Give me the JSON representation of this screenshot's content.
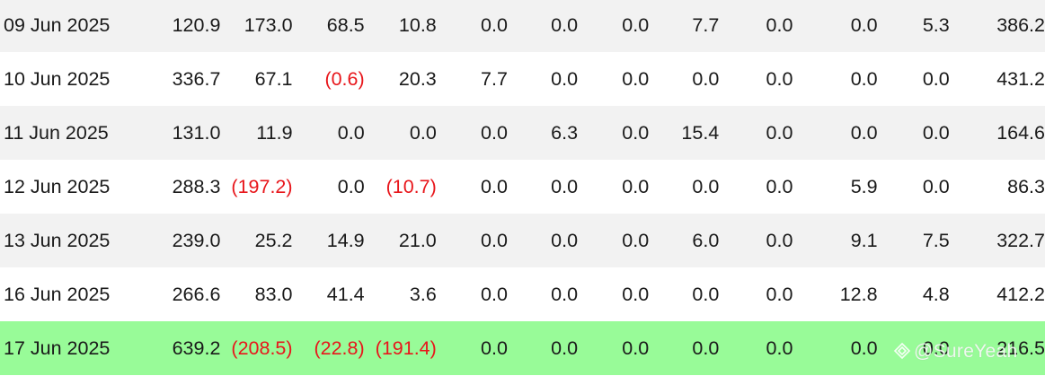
{
  "table": {
    "rows": [
      {
        "date": "09 Jun 2025",
        "values": [
          "120.9",
          "173.0",
          "68.5",
          "10.8",
          "0.0",
          "0.0",
          "0.0",
          "7.7",
          "0.0",
          "0.0",
          "5.3",
          "386.2"
        ],
        "negative": [
          false,
          false,
          false,
          false,
          false,
          false,
          false,
          false,
          false,
          false,
          false,
          false
        ],
        "highlight": false
      },
      {
        "date": "10 Jun 2025",
        "values": [
          "336.7",
          "67.1",
          "(0.6)",
          "20.3",
          "7.7",
          "0.0",
          "0.0",
          "0.0",
          "0.0",
          "0.0",
          "0.0",
          "431.2"
        ],
        "negative": [
          false,
          false,
          true,
          false,
          false,
          false,
          false,
          false,
          false,
          false,
          false,
          false
        ],
        "highlight": false
      },
      {
        "date": "11 Jun 2025",
        "values": [
          "131.0",
          "11.9",
          "0.0",
          "0.0",
          "0.0",
          "6.3",
          "0.0",
          "15.4",
          "0.0",
          "0.0",
          "0.0",
          "164.6"
        ],
        "negative": [
          false,
          false,
          false,
          false,
          false,
          false,
          false,
          false,
          false,
          false,
          false,
          false
        ],
        "highlight": false
      },
      {
        "date": "12 Jun 2025",
        "values": [
          "288.3",
          "(197.2)",
          "0.0",
          "(10.7)",
          "0.0",
          "0.0",
          "0.0",
          "0.0",
          "0.0",
          "5.9",
          "0.0",
          "86.3"
        ],
        "negative": [
          false,
          true,
          false,
          true,
          false,
          false,
          false,
          false,
          false,
          false,
          false,
          false
        ],
        "highlight": false
      },
      {
        "date": "13 Jun 2025",
        "values": [
          "239.0",
          "25.2",
          "14.9",
          "21.0",
          "0.0",
          "0.0",
          "0.0",
          "6.0",
          "0.0",
          "9.1",
          "7.5",
          "322.7"
        ],
        "negative": [
          false,
          false,
          false,
          false,
          false,
          false,
          false,
          false,
          false,
          false,
          false,
          false
        ],
        "highlight": false
      },
      {
        "date": "16 Jun 2025",
        "values": [
          "266.6",
          "83.0",
          "41.4",
          "3.6",
          "0.0",
          "0.0",
          "0.0",
          "0.0",
          "0.0",
          "12.8",
          "4.8",
          "412.2"
        ],
        "negative": [
          false,
          false,
          false,
          false,
          false,
          false,
          false,
          false,
          false,
          false,
          false,
          false
        ],
        "highlight": false
      },
      {
        "date": "17 Jun 2025",
        "values": [
          "639.2",
          "(208.5)",
          "(22.8)",
          "(191.4)",
          "0.0",
          "0.0",
          "0.0",
          "0.0",
          "0.0",
          "0.0",
          "0.0",
          "216.5"
        ],
        "negative": [
          false,
          true,
          true,
          true,
          false,
          false,
          false,
          false,
          false,
          false,
          false,
          false
        ],
        "highlight": true
      }
    ]
  },
  "colors": {
    "row_stripe": "#f2f2f2",
    "row_plain": "#ffffff",
    "row_highlight": "#98fb98",
    "negative_text": "#e8161b",
    "text": "#1a1a1a"
  },
  "watermark": {
    "text": "@SureYeah",
    "icon": "watermark-logo-icon"
  }
}
